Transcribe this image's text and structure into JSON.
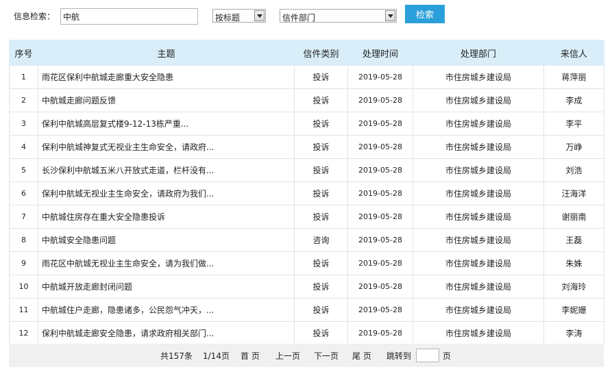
{
  "search": {
    "label": "信息检索：",
    "keyword": "中航",
    "field_select": "按标题",
    "dept_select": "信件部门",
    "button_label": "检索"
  },
  "table": {
    "headers": [
      "序号",
      "主题",
      "信件类别",
      "处理时间",
      "处理部门",
      "来信人"
    ],
    "rows": [
      {
        "no": "1",
        "subject": "雨花区保利中航城走廊重大安全隐患",
        "type": "投诉",
        "date": "2019-05-28",
        "dept": "市住房城乡建设局",
        "sender": "蒋萍丽"
      },
      {
        "no": "2",
        "subject": "中航城走廊问题反馈",
        "type": "投诉",
        "date": "2019-05-28",
        "dept": "市住房城乡建设局",
        "sender": "李成"
      },
      {
        "no": "3",
        "subject": "保利中航城高层复式楼9-12-13栋严重...",
        "type": "投诉",
        "date": "2019-05-28",
        "dept": "市住房城乡建设局",
        "sender": "李平"
      },
      {
        "no": "4",
        "subject": "保利中航城神复式无视业主生命安全，请政府...",
        "type": "投诉",
        "date": "2019-05-28",
        "dept": "市住房城乡建设局",
        "sender": "万峥"
      },
      {
        "no": "5",
        "subject": "长沙保利中航城五米八开放式走道，栏杆没有...",
        "type": "投诉",
        "date": "2019-05-28",
        "dept": "市住房城乡建设局",
        "sender": "刘浩"
      },
      {
        "no": "6",
        "subject": "保利中航城无视业主生命安全，请政府为我们...",
        "type": "投诉",
        "date": "2019-05-28",
        "dept": "市住房城乡建设局",
        "sender": "汪海洋"
      },
      {
        "no": "7",
        "subject": "中航城住房存在重大安全隐患投诉",
        "type": "投诉",
        "date": "2019-05-28",
        "dept": "市住房城乡建设局",
        "sender": "谢丽南"
      },
      {
        "no": "8",
        "subject": "中航城安全隐患问题",
        "type": "咨询",
        "date": "2019-05-28",
        "dept": "市住房城乡建设局",
        "sender": "王磊"
      },
      {
        "no": "9",
        "subject": "雨花区中航城无视业主生命安全，请为我们做...",
        "type": "投诉",
        "date": "2019-05-28",
        "dept": "市住房城乡建设局",
        "sender": "朱姝"
      },
      {
        "no": "10",
        "subject": "中航城开放走廊封闭问题",
        "type": "投诉",
        "date": "2019-05-28",
        "dept": "市住房城乡建设局",
        "sender": "刘海玲"
      },
      {
        "no": "11",
        "subject": "中航城住户走廊，隐患诸多，公民怨气冲天，...",
        "type": "投诉",
        "date": "2019-05-28",
        "dept": "市住房城乡建设局",
        "sender": "李妮姗"
      },
      {
        "no": "12",
        "subject": "保利中航城走廊安全隐患，请求政府相关部门...",
        "type": "投诉",
        "date": "2019-05-28",
        "dept": "市住房城乡建设局",
        "sender": "李涛"
      }
    ]
  },
  "pager": {
    "total": "共157条",
    "page_info": "1/14页",
    "first": "首 页",
    "prev": "上一页",
    "next": "下一页",
    "last": "尾 页",
    "jump_label": "跳转到",
    "jump_value": "",
    "page_unit": "页"
  }
}
